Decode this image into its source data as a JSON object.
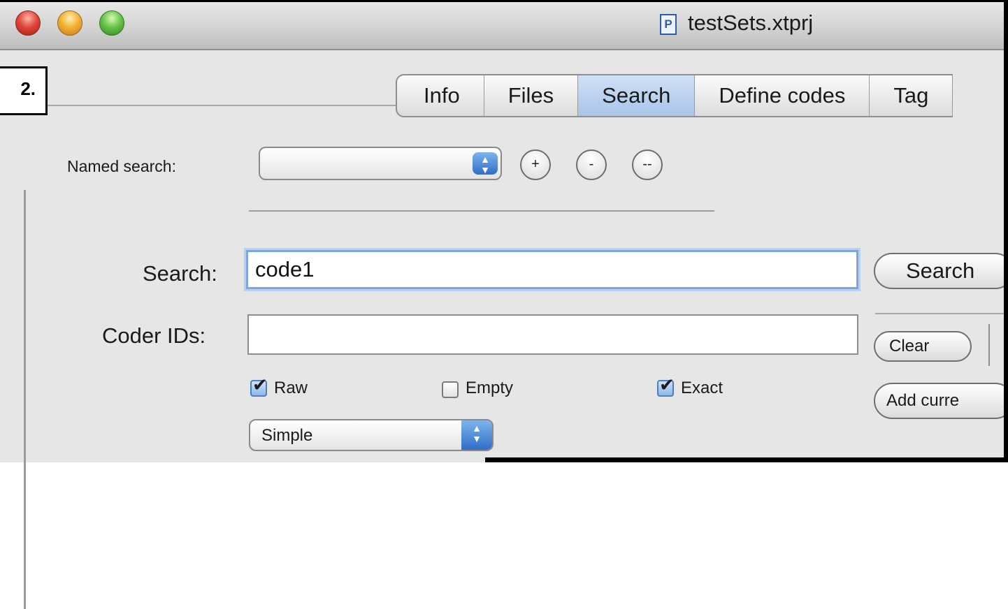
{
  "window": {
    "title": "testSets.xtprj",
    "doc_icon_letter": "P"
  },
  "annotation": {
    "label": "2."
  },
  "tabs": [
    {
      "label": "Info",
      "selected": false
    },
    {
      "label": "Files",
      "selected": false
    },
    {
      "label": "Search",
      "selected": true
    },
    {
      "label": "Define codes",
      "selected": false
    },
    {
      "label": "Tag",
      "selected": false
    }
  ],
  "named_search": {
    "label": "Named search:",
    "selected_value": "",
    "add_label": "+",
    "remove_label": "-",
    "remove_all_label": "--"
  },
  "search": {
    "label": "Search:",
    "value": "code1",
    "button_label": "Search"
  },
  "coder_ids": {
    "label": "Coder IDs:",
    "value": ""
  },
  "buttons": {
    "clear_label": "Clear",
    "add_current_label": "Add curre"
  },
  "options": {
    "raw": {
      "label": "Raw",
      "checked": true
    },
    "empty": {
      "label": "Empty",
      "checked": false
    },
    "exact": {
      "label": "Exact",
      "checked": true
    }
  },
  "mode": {
    "selected_value": "Simple"
  },
  "colors": {
    "selected_tab": "#a9c5ea",
    "focus_ring": "#7ea6dc",
    "popup_arrows": "#2f6fc7"
  }
}
